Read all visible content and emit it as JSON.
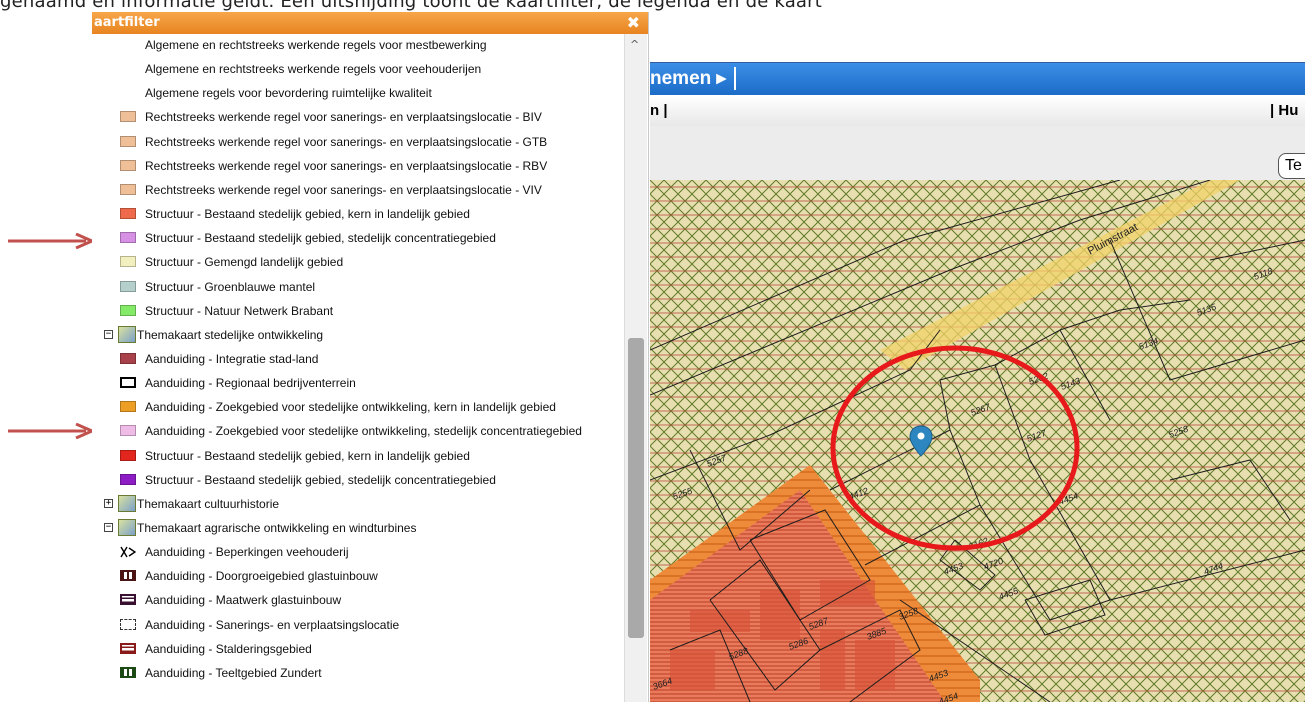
{
  "caption": "genaamd en informatie geldt. Een uitsnijding toont de kaartfilter, de legenda en de kaart",
  "panel": {
    "title": "aartfilter",
    "close_glyph": "✖",
    "scroll_up_glyph": "^"
  },
  "legend": [
    {
      "label": "Algemene en rechtstreeks werkende regels voor mestbewerking",
      "swatch": "none"
    },
    {
      "label": "Algemene en rechtstreeks werkende regels voor veehouderijen",
      "swatch": "none"
    },
    {
      "label": "Algemene regels voor bevordering ruimtelijke kwaliteit",
      "swatch": "none"
    },
    {
      "label": "Rechtstreeks werkende regel voor sanerings- en verplaatsingslocatie - BIV",
      "swatch": "#efbf97"
    },
    {
      "label": "Rechtstreeks werkende regel voor sanerings- en verplaatsingslocatie - GTB",
      "swatch": "#efbf97"
    },
    {
      "label": "Rechtstreeks werkende regel voor sanerings- en verplaatsingslocatie - RBV",
      "swatch": "#efbf97"
    },
    {
      "label": "Rechtstreeks werkende regel voor sanerings- en verplaatsingslocatie - VIV",
      "swatch": "#efbf97"
    },
    {
      "label": "Structuur - Bestaand stedelijk gebied, kern in landelijk gebied",
      "swatch": "#ee6a4a"
    },
    {
      "label": "Structuur - Bestaand stedelijk gebied, stedelijk concentratiegebied",
      "swatch": "#d690e4"
    },
    {
      "label": "Structuur - Gemengd landelijk gebied",
      "swatch": "#f3f0bf"
    },
    {
      "label": "Structuur - Groenblauwe mantel",
      "swatch": "#b5cfcd"
    },
    {
      "label": "Structuur - Natuur Netwerk Brabant",
      "swatch": "#86ea69"
    },
    {
      "label": "Themakaart stedelijke ontwikkeling",
      "swatch": "theme",
      "toggle": "−"
    },
    {
      "label": "Aanduiding - Integratie stad-land",
      "swatch": "#a9414a"
    },
    {
      "label": "Aanduiding - Regionaal bedrijventerrein",
      "swatch": "outline"
    },
    {
      "label": "Aanduiding - Zoekgebied voor stedelijke ontwikkeling, kern in landelijk gebied",
      "swatch": "#ec9f24"
    },
    {
      "label": "Aanduiding - Zoekgebied voor stedelijke ontwikkeling, stedelijk concentratiegebied",
      "swatch": "#eebce7"
    },
    {
      "label": "Structuur - Bestaand stedelijk gebied, kern in landelijk gebied",
      "swatch": "#e2261d"
    },
    {
      "label": "Structuur - Bestaand stedelijk gebied, stedelijk concentratiegebied",
      "swatch": "#8d1cc4"
    },
    {
      "label": "Themakaart cultuurhistorie",
      "swatch": "theme",
      "toggle": "+"
    },
    {
      "label": "Themakaart agrarische ontwikkeling en windturbines",
      "swatch": "theme",
      "toggle": "−"
    },
    {
      "label": "Aanduiding - Beperkingen veehouderij",
      "swatch": "xo"
    },
    {
      "label": "Aanduiding - Doorgroeigebied glastuinbouw",
      "swatch": "vbars"
    },
    {
      "label": "Aanduiding - Maatwerk glastuinbouw",
      "swatch": "hbars"
    },
    {
      "label": "Aanduiding - Sanerings- en verplaatsingslocatie",
      "swatch": "dashed"
    },
    {
      "label": "Aanduiding - Stalderingsgebied",
      "swatch": "hbars-red"
    },
    {
      "label": "Aanduiding - Teeltgebied Zundert",
      "swatch": "vbars-green"
    }
  ],
  "app": {
    "nav_label": "nemen ▸",
    "toolbar_left": "n  |",
    "toolbar_right": "|  Hu",
    "te_button": "Te"
  },
  "map": {
    "street_name": "Pluimstraat",
    "parcel_numbers": [
      "5118",
      "5135",
      "5134",
      "5143",
      "5262",
      "5267",
      "5127",
      "5258",
      "5257",
      "5255",
      "4412",
      "4454",
      "5162",
      "4720",
      "4453",
      "4455",
      "3258",
      "3885",
      "5287",
      "5286",
      "5288",
      "3664",
      "4453",
      "4454",
      "4744"
    ],
    "colors": {
      "hatch_green": "#5f7a28",
      "hatch_red": "#b94a3c",
      "hatch_bg": "#e8dfb0",
      "orange_zone": "#ee8b3a",
      "urban_red": "#ea7a5c",
      "marker": "#2e86c1",
      "circle": "#e8191b",
      "arrow": "#c0514d"
    }
  },
  "arrows": [
    {
      "target": "legend.7"
    },
    {
      "target": "legend.15"
    }
  ]
}
